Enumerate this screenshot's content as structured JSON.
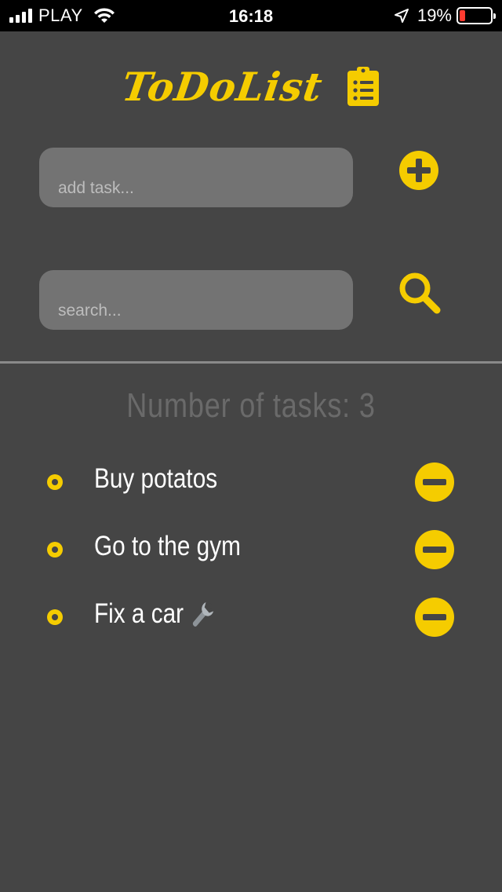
{
  "status_bar": {
    "carrier": "PLAY",
    "time": "16:18",
    "battery_percent": "19%",
    "battery_level": 0.19,
    "icons": [
      "signal-icon",
      "wifi-icon",
      "location-arrow-icon",
      "battery-icon"
    ]
  },
  "header": {
    "title": "ToDoList",
    "icon": "clipboard-list-icon"
  },
  "add_task": {
    "placeholder": "add task...",
    "value": "",
    "button_icon": "plus-circle-icon"
  },
  "search": {
    "placeholder": "search...",
    "value": "",
    "button_icon": "search-icon"
  },
  "counter": {
    "text": "Number of tasks: 3"
  },
  "tasks": [
    {
      "label": "Buy potatos",
      "remove_icon": "minus-circle-icon"
    },
    {
      "label": "Go to the gym",
      "remove_icon": "minus-circle-icon"
    },
    {
      "label": "Fix a car",
      "emoji_icon": "wrench-icon",
      "remove_icon": "minus-circle-icon"
    }
  ],
  "colors": {
    "accent": "#f5cc00",
    "background": "#454545",
    "input_bg": "#737373",
    "counter_text": "#6a6a6a"
  }
}
